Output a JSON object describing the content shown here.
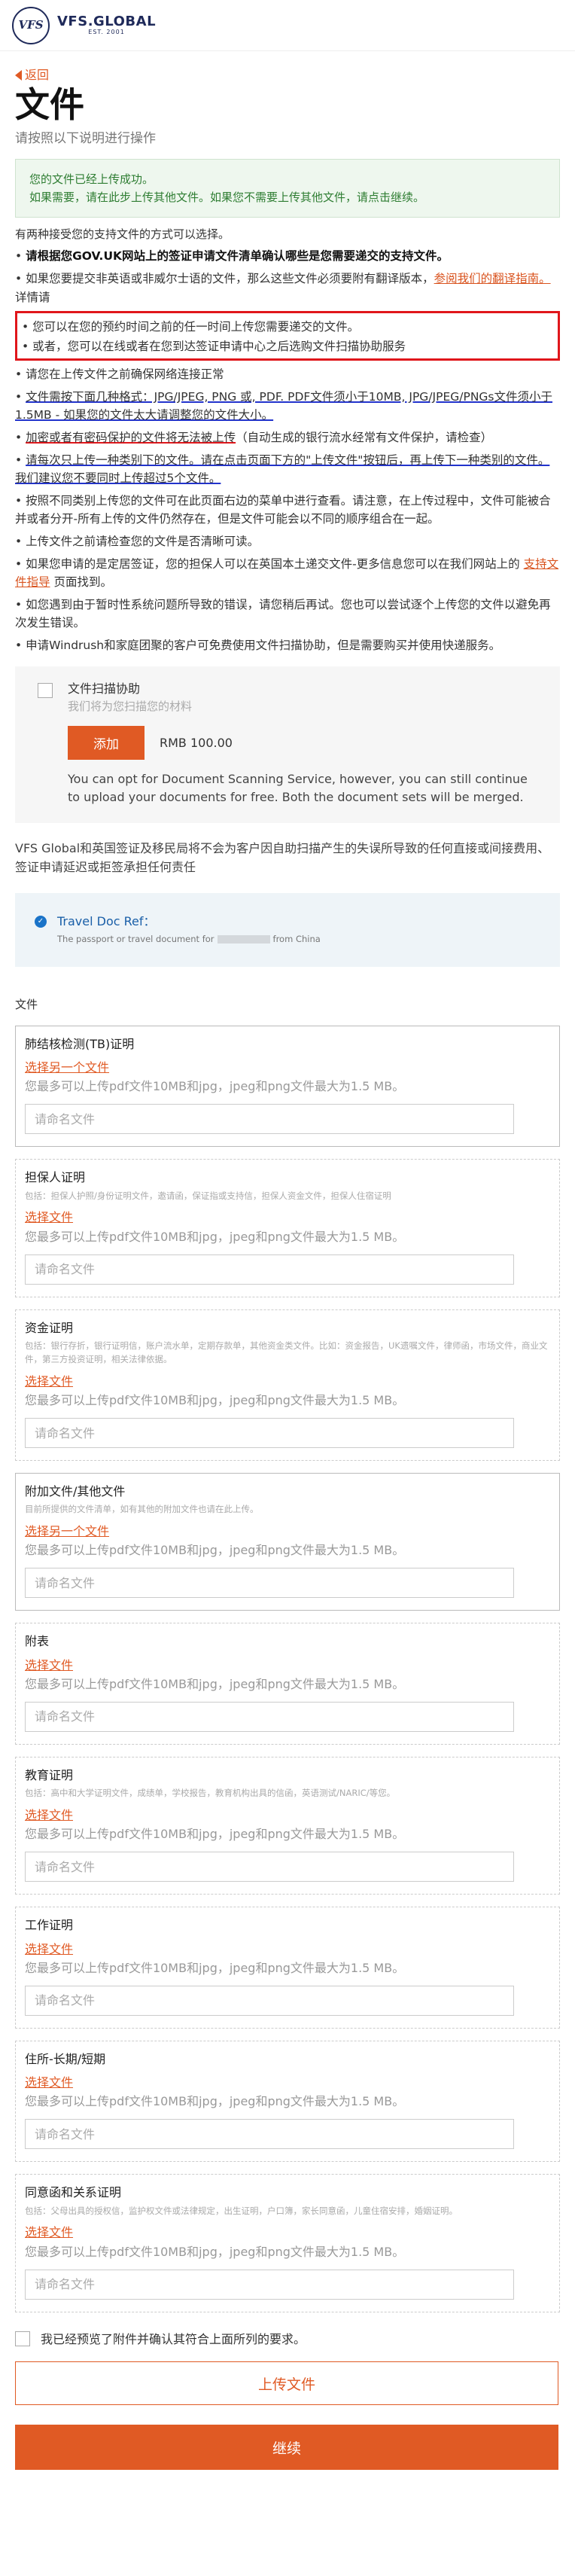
{
  "header": {
    "logo_mark": "VFS",
    "logo_text": "VFS.GLOBAL",
    "logo_sub": "EST. 2001"
  },
  "nav": {
    "back": "返回"
  },
  "page": {
    "title": "文件",
    "subtitle": "请按照以下说明进行操作"
  },
  "success": {
    "line1": "您的文件已经上传成功。",
    "line2": "如果需要，请在此步上传其他文件。如果您不需要上传其他文件，请点击继续。"
  },
  "intro": "有两种接受您的支持文件的方式可以选择。",
  "bullets": {
    "b1": "请根据您GOV.UK网站上的签证申请文件清单确认哪些是您需要递交的支持文件。",
    "b2_pre": "如果您要提交非英语或非威尔士语的文件，那么这些文件必须要附有翻译版本，",
    "b2_link": "参阅我们的翻译指南。",
    "b2_post": " 详情请",
    "b3": "您可以在您的预约时间之前的任一时间上传您需要递交的文件。",
    "b4": "或者，您可以在线或者在您到达签证申请中心之后选购文件扫描协助服务",
    "b5": "请您在上传文件之前确保网络连接正常",
    "b6": "文件需按下面几种格式：JPG/JPEG, PNG 或, PDF. PDF文件须小于10MB, JPG/JPEG/PNGs文件须小于1.5MB - 如果您的文件太大请调整您的文件大小。",
    "b7_pre": "加密或者有密码保护的文件将无法被上传",
    "b7_post": "（自动生成的银行流水经常有文件保护，请检查）",
    "b8": "请每次只上传一种类别下的文件。请在点击页面下方的\"上传文件\"按钮后，再上传下一种类别的文件。我们建议您不要同时上传超过5个文件。",
    "b9": "按照不同类别上传您的文件可在此页面右边的菜单中进行查看。请注意，在上传过程中，文件可能被合并或者分开-所有上传的文件仍然存在，但是文件可能会以不同的顺序组合在一起。",
    "b10": "上传文件之前请检查您的文件是否清晰可读。",
    "b11_pre": "如果您申请的是定居签证，您的担保人可以在英国本土递交文件-更多信息您可以在我们网站上的 ",
    "b11_link": "支持文件指导",
    "b11_post": " 页面找到。",
    "b12": "如您遇到由于暂时性系统问题所导致的错误，请您稍后再试。您也可以尝试逐个上传您的文件以避免再次发生错误。",
    "b13": "申请Windrush和家庭团聚的客户可免费使用文件扫描协助，但是需要购买并使用快递服务。"
  },
  "scan": {
    "title": "文件扫描协助",
    "desc": "我们将为您扫描您的材料",
    "add_label": "添加",
    "price": "RMB 100.00",
    "note": "You can opt for Document Scanning Service, however, you can still continue to upload your documents for free. Both the document sets will be merged."
  },
  "disclaimer": "VFS Global和英国签证及移民局将不会为客户因自助扫描产生的失误所导致的任何直接或间接费用、签证申请延迟或拒签承担任何责任",
  "travel": {
    "title": "Travel Doc Ref：",
    "sub_pre": "The passport or travel document for",
    "sub_post": "from China"
  },
  "files_label": "文件",
  "cards": [
    {
      "title": "肺结核检测(TB)证明",
      "desc": "",
      "link": "选择另一个文件",
      "hint": "您最多可以上传pdf文件10MB和jpg，jpeg和png文件最大为1.5 MB。",
      "placeholder": "请命名文件"
    },
    {
      "title": "担保人证明",
      "desc": "包括：担保人护照/身份证明文件，邀请函，保证指或支持信，担保人资金文件，担保人住宿证明",
      "link": "选择文件",
      "hint": "您最多可以上传pdf文件10MB和jpg，jpeg和png文件最大为1.5 MB。",
      "placeholder": "请命名文件"
    },
    {
      "title": "资金证明",
      "desc": "包括：银行存折，银行证明信，账户流水单，定期存款单，其他资金类文件。比如：资金报告，UK遗嘱文件，律师函，市场文件，商业文件，第三方投资证明，相关法律依据。",
      "link": "选择文件",
      "hint": "您最多可以上传pdf文件10MB和jpg，jpeg和png文件最大为1.5 MB。",
      "placeholder": "请命名文件"
    },
    {
      "title": "附加文件/其他文件",
      "desc": "目前所提供的文件清单，如有其他的附加文件也请在此上传。",
      "link": "选择另一个文件",
      "hint": "您最多可以上传pdf文件10MB和jpg，jpeg和png文件最大为1.5 MB。",
      "placeholder": "请命名文件"
    },
    {
      "title": "附表",
      "desc": "",
      "link": "选择文件",
      "hint": "您最多可以上传pdf文件10MB和jpg，jpeg和png文件最大为1.5 MB。",
      "placeholder": "请命名文件"
    },
    {
      "title": "教育证明",
      "desc": "包括：高中和大学证明文件，成绩单，学校报告，教育机构出具的信函，英语测试/NARIC/等您。",
      "link": "选择文件",
      "hint": "您最多可以上传pdf文件10MB和jpg，jpeg和png文件最大为1.5 MB。",
      "placeholder": "请命名文件"
    },
    {
      "title": "工作证明",
      "desc": "",
      "link": "选择文件",
      "hint": "您最多可以上传pdf文件10MB和jpg，jpeg和png文件最大为1.5 MB。",
      "placeholder": "请命名文件"
    },
    {
      "title": "住所-长期/短期",
      "desc": "",
      "link": "选择文件",
      "hint": "您最多可以上传pdf文件10MB和jpg，jpeg和png文件最大为1.5 MB。",
      "placeholder": "请命名文件"
    },
    {
      "title": "同意函和关系证明",
      "desc": "包括：父母出具的授权信，监护权文件或法律规定，出生证明，户口簿，家长同意函，儿童住宿安排，婚姻证明。",
      "link": "选择文件",
      "hint": "您最多可以上传pdf文件10MB和jpg，jpeg和png文件最大为1.5 MB。",
      "placeholder": "请命名文件"
    }
  ],
  "agree": "我已经预览了附件并确认其符合上面所列的要求。",
  "buttons": {
    "upload": "上传文件",
    "continue": "继续"
  },
  "colors": {
    "accent": "#e05a24",
    "success_text": "#2e7d32",
    "link_blue": "#1a5fa8",
    "annotation_red": "#e0161b"
  }
}
